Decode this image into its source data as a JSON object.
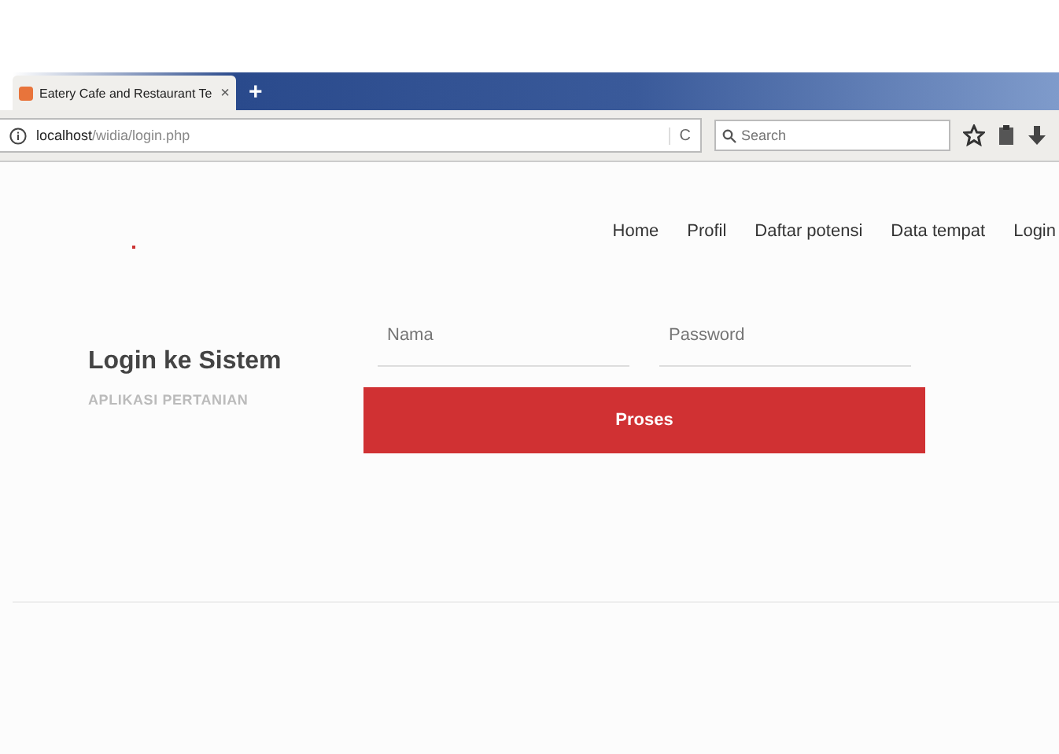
{
  "browser": {
    "tab_title": "Eatery Cafe and Restaurant Te",
    "tab_close": "×",
    "new_tab": "+",
    "url_host": "localhost",
    "url_path": "/widia/login.php",
    "reload": "C",
    "search": {
      "placeholder": "Search"
    }
  },
  "nav": [
    {
      "label": "Home"
    },
    {
      "label": "Profil"
    },
    {
      "label": "Daftar potensi"
    },
    {
      "label": "Data tempat"
    },
    {
      "label": "Login"
    }
  ],
  "login": {
    "title": "Login ke Sistem",
    "subtitle": "APLIKASI PERTANIAN",
    "fields": [
      {
        "placeholder": "Nama"
      },
      {
        "placeholder": "Password"
      }
    ],
    "button": "Proses"
  }
}
